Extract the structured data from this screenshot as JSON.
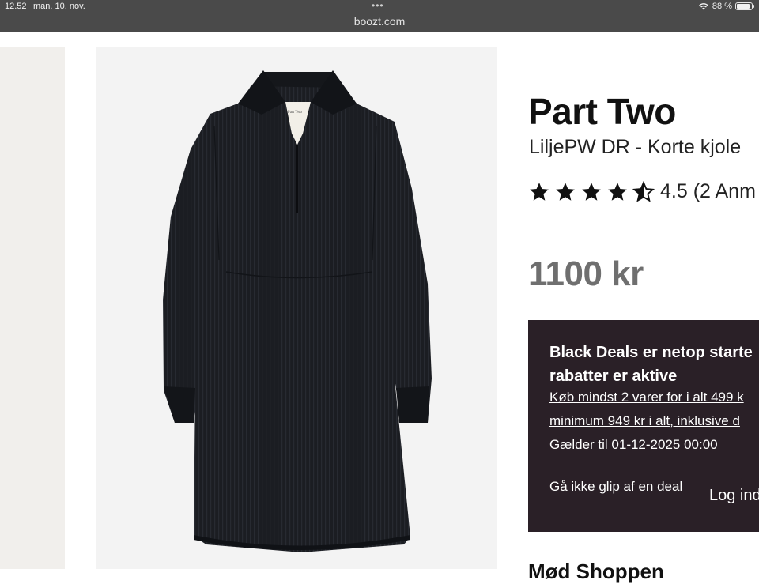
{
  "status_bar": {
    "time": "12.52",
    "date": "man. 10. nov.",
    "dots": "•••",
    "battery": "88 %",
    "battery_level": 0.88
  },
  "browser": {
    "url": "boozt.com"
  },
  "product": {
    "brand": "Part Two",
    "name": "LiljePW DR - Korte kjole",
    "rating_value": 4.5,
    "rating_text": "4.5 (2 Anm",
    "price": "1100 kr",
    "image_colors": {
      "background": "#f3f3f3",
      "dress": "#1b1d22"
    }
  },
  "promo": {
    "title_line1": "Black Deals er netop starte",
    "title_line2": "rabatter er aktive",
    "link_line1": "Køb mindst 2 varer for i alt 499 k",
    "link_line2": "minimum 949 kr i alt, inklusive d",
    "link_line3": "Gælder til 01-12-2025 00:00",
    "deal_text": "Gå ikke glip af en deal",
    "login_label": "Log ind",
    "background": "#2a2027"
  },
  "next_section": {
    "heading": "Mød Shoppen"
  }
}
